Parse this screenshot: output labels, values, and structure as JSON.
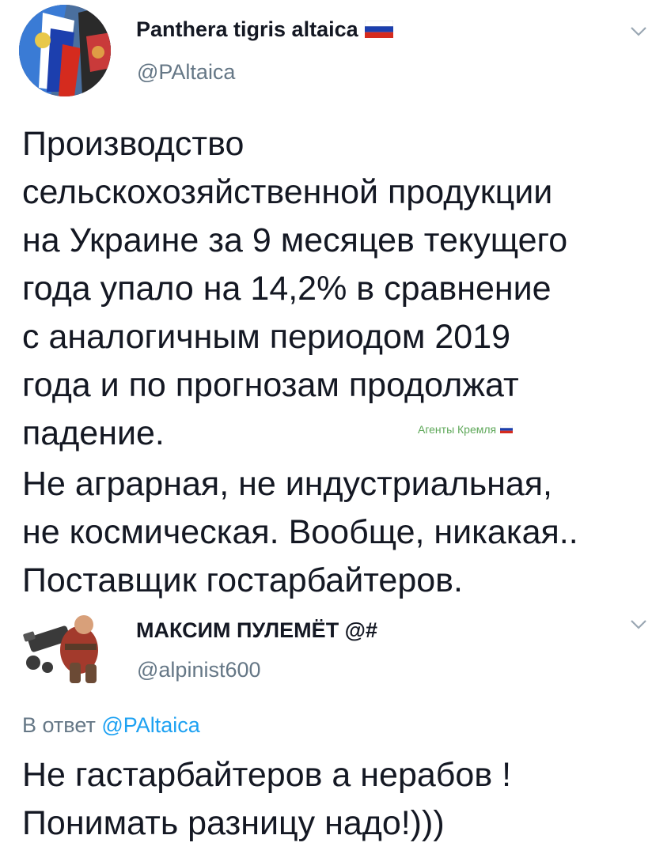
{
  "tweet": {
    "author_name": "Panthera tigris altaica",
    "author_handle": "@PAltaica",
    "menu_icon": "chevron-down-icon",
    "text_lines": [
      "Производство",
      "сельскохозяйственной продукции",
      "на Украине за 9 месяцев текущего",
      "года упало на 14,2% в сравнение",
      "с аналогичным периодом 2019",
      "года и по прогнозам продолжат",
      "падение."
    ],
    "text_lines_2": [
      "Не аграрная, не индустриальная,",
      "не космическая. Вообще, никакая..",
      "Поставщик гостарбайтеров."
    ]
  },
  "watermark": {
    "text": "Агенты Кремля",
    "color": "#5fa85a"
  },
  "reply": {
    "author_name": "МАКСИМ ПУЛЕМЁТ @#",
    "author_handle": "@alpinist600",
    "menu_icon": "chevron-down-icon",
    "reply_prefix": "В ответ",
    "reply_mention": "@PAltaica",
    "text_lines": [
      "Не гастарбайтеров а нерабов !",
      "Понимать разницу надо!)))"
    ]
  },
  "colors": {
    "text": "#141823",
    "secondary": "#657786",
    "link": "#1da1f2",
    "flag_white": "#ffffff",
    "flag_blue": "#1c3fae",
    "flag_red": "#d52b1e"
  }
}
